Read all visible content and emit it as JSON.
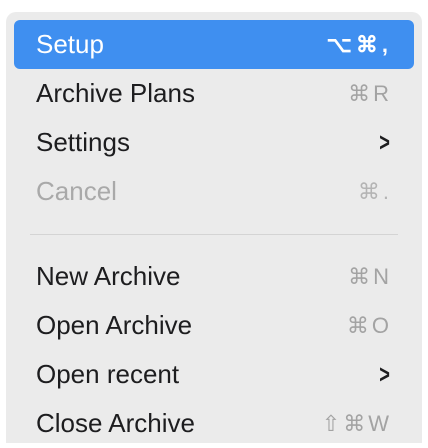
{
  "menu": {
    "items": [
      {
        "label": "Setup",
        "shortcut": "⌥⌘,",
        "state": "selected"
      },
      {
        "label": "Archive Plans",
        "shortcut": "⌘R",
        "state": "normal"
      },
      {
        "label": "Settings",
        "submenu": true,
        "state": "normal"
      },
      {
        "label": "Cancel",
        "shortcut": "⌘.",
        "state": "disabled"
      }
    ],
    "items2": [
      {
        "label": "New Archive",
        "shortcut": "⌘N",
        "state": "normal"
      },
      {
        "label": "Open Archive",
        "shortcut": "⌘O",
        "state": "normal"
      },
      {
        "label": "Open recent",
        "submenu": true,
        "state": "normal"
      },
      {
        "label": "Close Archive",
        "shortcut": "⇧⌘W",
        "state": "normal"
      }
    ],
    "chevron_glyph": ">",
    "colors": {
      "highlight": "#3f8ff0",
      "background": "#ebebeb",
      "text": "#1d1d1f",
      "disabled": "#a9a9a9"
    }
  }
}
